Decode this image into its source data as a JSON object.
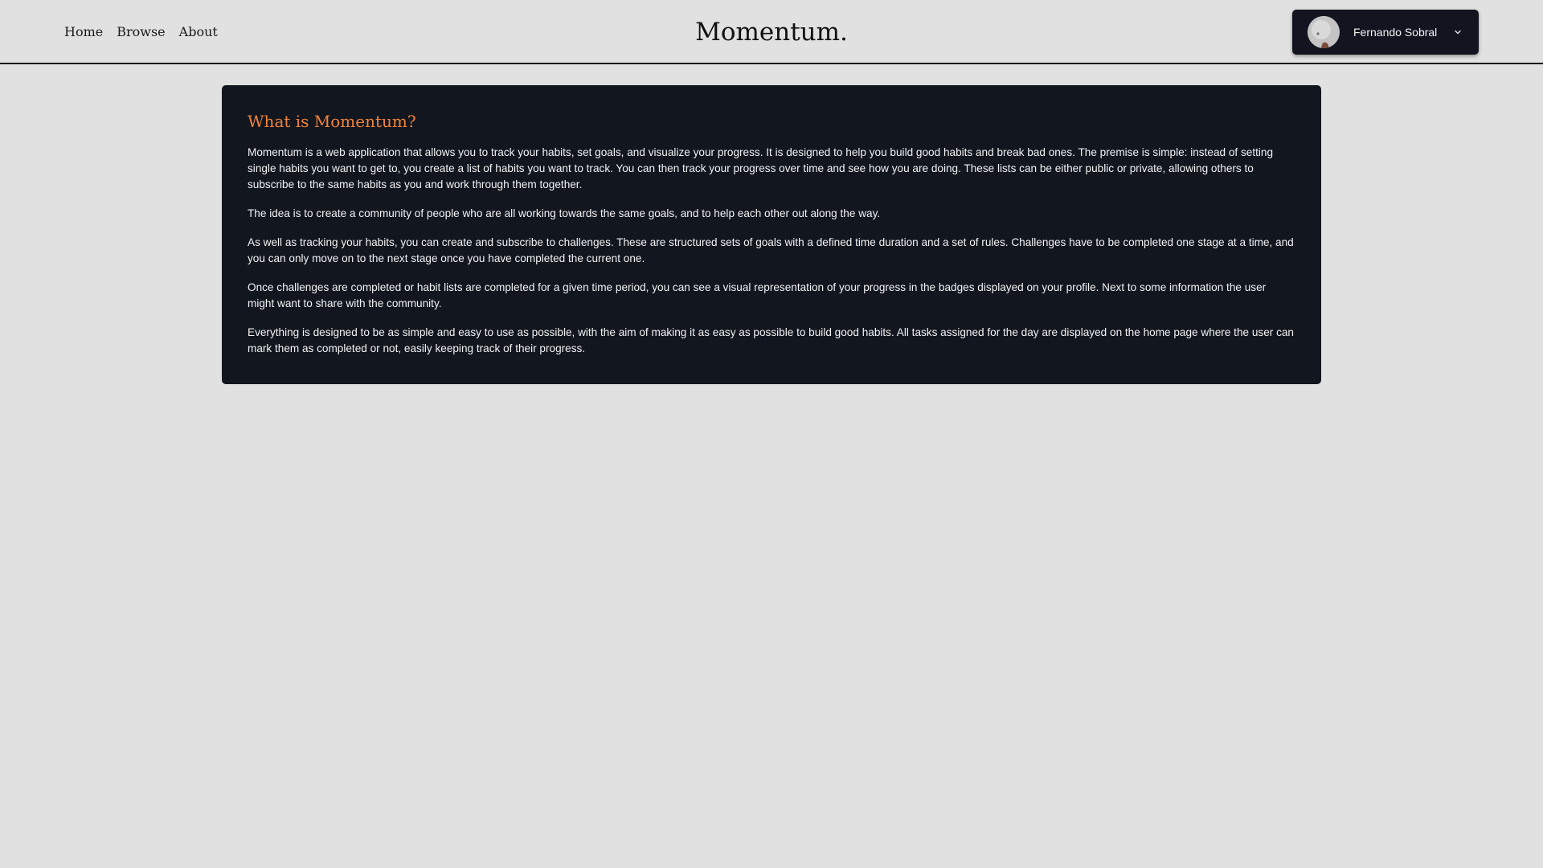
{
  "header": {
    "nav": {
      "home": "Home",
      "browse": "Browse",
      "about": "About"
    },
    "brand": "Momentum.",
    "user": {
      "name": "Fernando Sobral",
      "avatar_icon": "user-avatar",
      "dropdown_icon": "chevron-down-icon"
    }
  },
  "about": {
    "title": "What is Momentum?",
    "paragraphs": [
      "Momentum is a web application that allows you to track your habits, set goals, and visualize your progress. It is designed to help you build good habits and break bad ones. The premise is simple: instead of setting single habits you want to get to, you create a list of habits you want to track. You can then track your progress over time and see how you are doing. These lists can be either public or private, allowing others to subscribe to the same habits as you and work through them together.",
      "The idea is to create a community of people who are all working towards the same goals, and to help each other out along the way.",
      "As well as tracking your habits, you can create and subscribe to challenges. These are structured sets of goals with a defined time duration and a set of rules. Challenges have to be completed one stage at a time, and you can only move on to the next stage once you have completed the current one.",
      "Once challenges are completed or habit lists are completed for a given time period, you can see a visual representation of your progress in the badges displayed on your profile. Next to some information the user might want to share with the community.",
      "Everything is designed to be as simple and easy to use as possible, with the aim of making it as easy as possible to build good habits. All tasks assigned for the day are displayed on the home page where the user can mark them as completed or not, easily keeping track of their progress."
    ]
  },
  "colors": {
    "page_background": "#e1e1e1",
    "card_background": "#12161f",
    "accent": "#f0833a",
    "text_light": "#f3f3f3",
    "text_dark": "#1b1b1b"
  }
}
